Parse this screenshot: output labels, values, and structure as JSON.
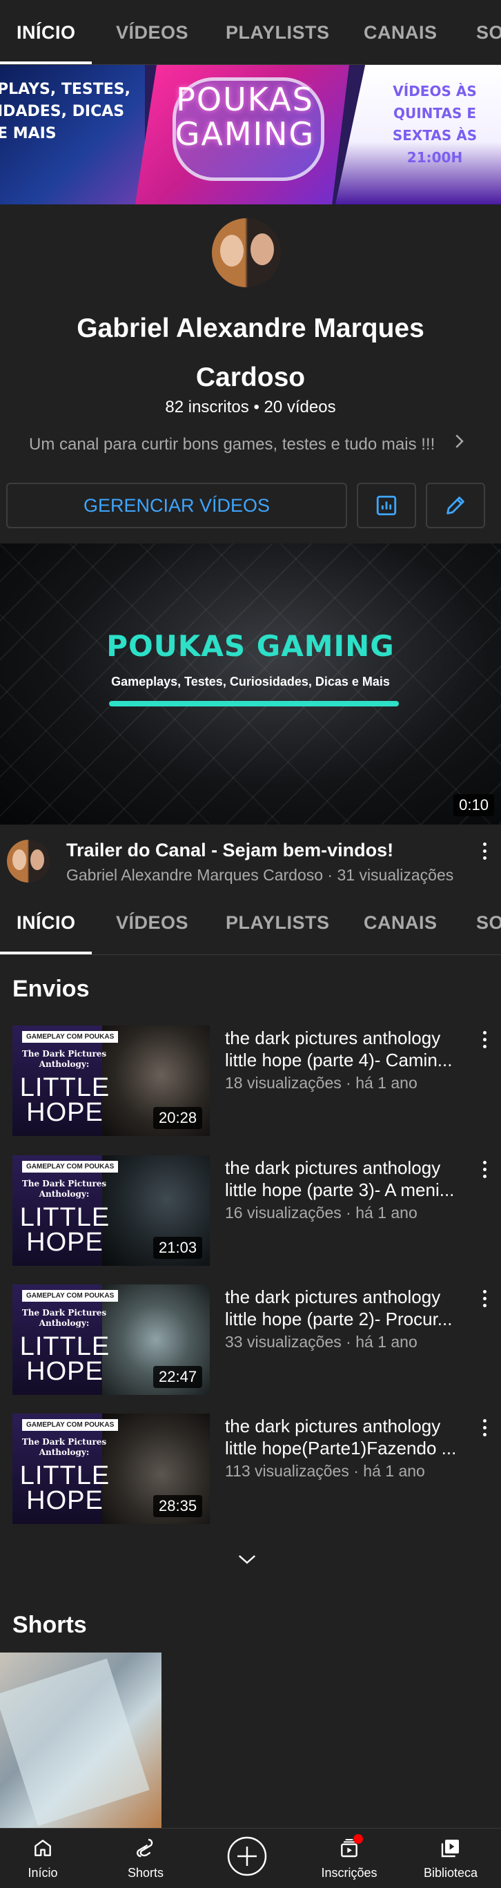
{
  "tabs": [
    "INÍCIO",
    "VÍDEOS",
    "PLAYLISTS",
    "CANAIS",
    "SOBRE"
  ],
  "banner": {
    "left_text": "PLAYS, TESTES, IDADES, DICAS E MAIS",
    "title": "POUKAS GAMING",
    "right_text": "VÍDEOS ÀS QUINTAS E SEXTAS ÀS 21:00H"
  },
  "channel": {
    "name": "Gabriel Alexandre Marques Cardoso",
    "stats": "82 inscritos • 20 vídeos",
    "description": "Um canal para  curtir bons games, testes e tudo mais !!!"
  },
  "actions": {
    "manage_label": "GERENCIAR VÍDEOS",
    "analytics_icon": "analytics-icon",
    "edit_icon": "pencil-icon"
  },
  "trailer": {
    "thumb_title": "POUKAS GAMING",
    "thumb_subtitle": "Gameplays, Testes, Curiosidades, Dicas e Mais",
    "duration": "0:10",
    "title": "Trailer do Canal - Sejam bem-vindos!",
    "subtitle": "Gabriel Alexandre Marques Cardoso · 31 visualizações"
  },
  "uploads": {
    "section_title": "Envios",
    "thumb_tag": "GAMEPLAY COM POUKAS",
    "thumb_anthology": "The Dark Pictures Anthology:",
    "thumb_line1": "LITTLE",
    "thumb_line2": "HOPE",
    "items": [
      {
        "title": "the dark pictures anthology little hope (parte 4)- Camin...",
        "meta": "18 visualizações · há 1 ano",
        "duration": "20:28"
      },
      {
        "title": "the dark pictures anthology little hope (parte 3)- A meni...",
        "meta": "16 visualizações · há 1 ano",
        "duration": "21:03"
      },
      {
        "title": "the dark pictures anthology little hope (parte 2)- Procur...",
        "meta": "33 visualizações · há 1 ano",
        "duration": "22:47"
      },
      {
        "title": "the dark pictures anthology little hope(Parte1)Fazendo ...",
        "meta": "113 visualizações · há 1 ano",
        "duration": "28:35"
      }
    ]
  },
  "shorts": {
    "section_title": "Shorts"
  },
  "bottom_nav": {
    "items": [
      {
        "label": "Início",
        "icon": "home-icon"
      },
      {
        "label": "Shorts",
        "icon": "shorts-icon"
      },
      {
        "label": "",
        "icon": "create-icon"
      },
      {
        "label": "Inscrições",
        "icon": "subscriptions-icon"
      },
      {
        "label": "Biblioteca",
        "icon": "library-icon"
      }
    ]
  },
  "colors": {
    "background": "#212121",
    "accent_blue": "#3ea6ff",
    "secondary_text": "#aaaaaa",
    "notification_red": "#ff0000"
  }
}
